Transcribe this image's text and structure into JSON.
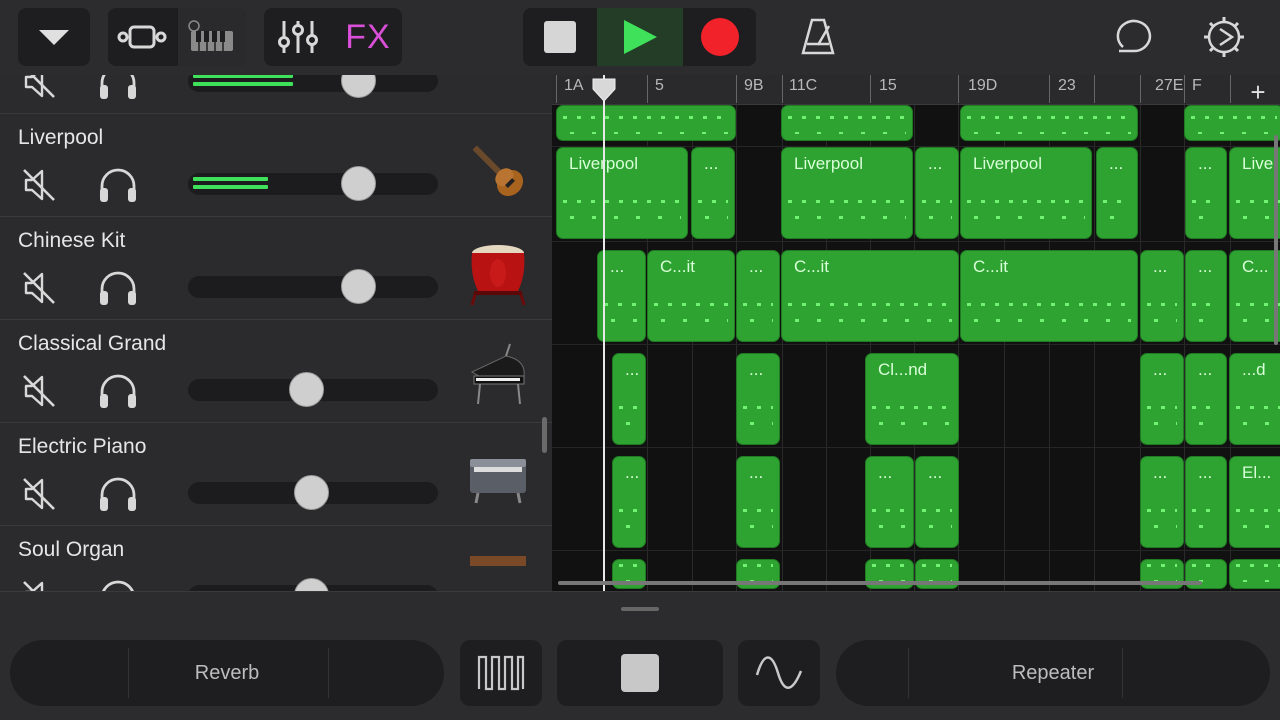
{
  "toolbar": {
    "fx_label": "FX"
  },
  "tracks": [
    {
      "name": "",
      "volume": 0.68,
      "meter": 0.4
    },
    {
      "name": "Liverpool",
      "volume": 0.68,
      "meter": 0.3
    },
    {
      "name": "Chinese Kit",
      "volume": 0.68,
      "meter": 0
    },
    {
      "name": "Classical Grand",
      "volume": 0.47,
      "meter": 0
    },
    {
      "name": "Electric Piano",
      "volume": 0.49,
      "meter": 0
    },
    {
      "name": "Soul Organ",
      "volume": 0.49,
      "meter": 0
    }
  ],
  "ruler": {
    "labels": [
      "1A",
      "5",
      "9B",
      "11C",
      "15",
      "19D",
      "23",
      "27E",
      "F"
    ],
    "add_label": "+"
  },
  "regions": {
    "drums": [
      "",
      "",
      "",
      ""
    ],
    "liverpool": [
      "Liverpool",
      "...",
      "Liverpool",
      "...",
      "Liverpool",
      "...",
      "...",
      "Live"
    ],
    "chinese": [
      "...",
      "C...it",
      "...",
      "C...it",
      "C...it",
      "...",
      "...",
      "C..."
    ],
    "grand": [
      "...",
      "...",
      "Cl...nd",
      "...",
      "...",
      "...d"
    ],
    "epiano": [
      "...",
      "...",
      "...",
      "...",
      "...",
      "...",
      "El..."
    ],
    "organ": [
      "",
      "",
      "",
      "",
      "",
      "",
      ""
    ]
  },
  "bottom": {
    "left_effect": "Reverb",
    "right_effect": "Repeater"
  },
  "colors": {
    "region_green": "#2fa331",
    "play_green": "#3fe05a",
    "record_red": "#f2222a",
    "fx_magenta": "#d94fd8"
  }
}
